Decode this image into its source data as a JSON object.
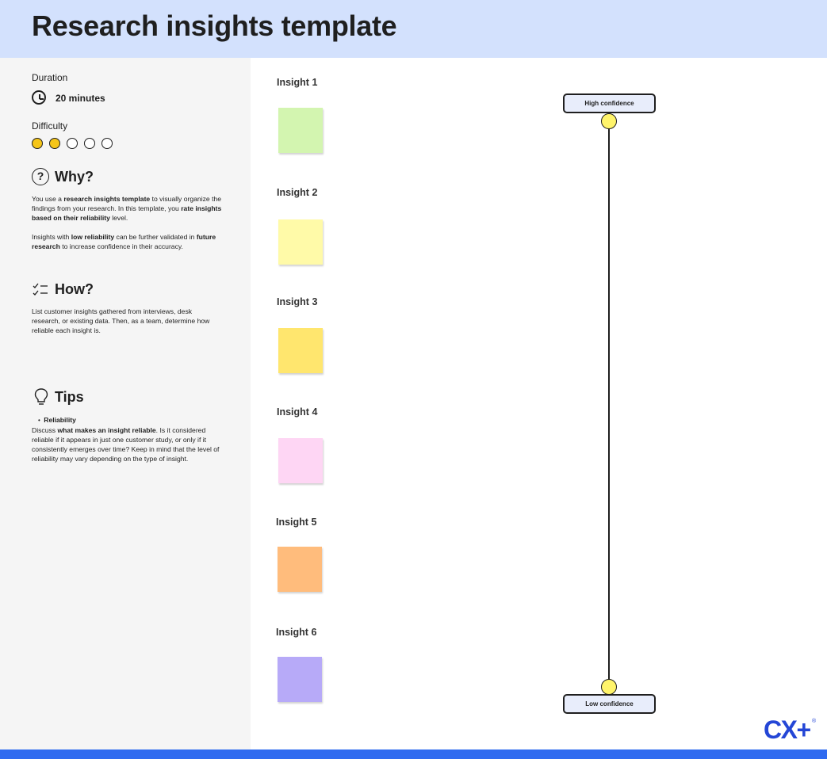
{
  "page": {
    "title": "Research insights template"
  },
  "colors": {
    "header_bg": "#d3e1fd",
    "sidebar_bg": "#f5f5f5",
    "footer_bar": "#2f6bf0",
    "difficulty_on": "#f5c518",
    "confidence_dot": "#fff46b",
    "logo": "#2446d6"
  },
  "meta": {
    "duration_label": "Duration",
    "duration_value": "20 minutes",
    "duration_icon": "clock-icon",
    "difficulty_label": "Difficulty",
    "difficulty_level": 2,
    "difficulty_max": 5
  },
  "why": {
    "title": "Why?",
    "icon": "question-circle-icon",
    "p1_a": "You use a ",
    "p1_b": "research insights template",
    "p1_c": " to visually organize the findings from your research. In this template, you ",
    "p1_d": "rate insights based on their reliability",
    "p1_e": " level.",
    "p2_a": "Insights with ",
    "p2_b": "low reliability",
    "p2_c": " can be further validated in ",
    "p2_d": "future research",
    "p2_e": " to increase confidence in their accuracy."
  },
  "how": {
    "title": "How?",
    "icon": "checklist-icon",
    "text": "List customer insights gathered from interviews, desk research, or existing data. Then, as a team, determine how reliable each insight is."
  },
  "tips": {
    "title": "Tips",
    "icon": "lightbulb-icon",
    "bullet": "Reliability",
    "t_a": "Discuss ",
    "t_b": "what makes an insight reliable",
    "t_c": ". Is it considered reliable if it appears in just one customer study, or only if it consistently emerges over time? Keep in mind that the level of reliability may vary depending on the type of insight."
  },
  "insights": [
    {
      "label": "Insight 1",
      "color": "#d3f5b0"
    },
    {
      "label": "Insight 2",
      "color": "#fffaa8"
    },
    {
      "label": "Insight 3",
      "color": "#ffe66e"
    },
    {
      "label": "Insight 4",
      "color": "#fed6f4"
    },
    {
      "label": "Insight 5",
      "color": "#ffbc7c"
    },
    {
      "label": "Insight 6",
      "color": "#b7aaf8"
    }
  ],
  "confidence": {
    "high_label": "High confidence",
    "low_label": "Low confidence"
  },
  "logo": {
    "text": "CX+",
    "mark": "®"
  }
}
